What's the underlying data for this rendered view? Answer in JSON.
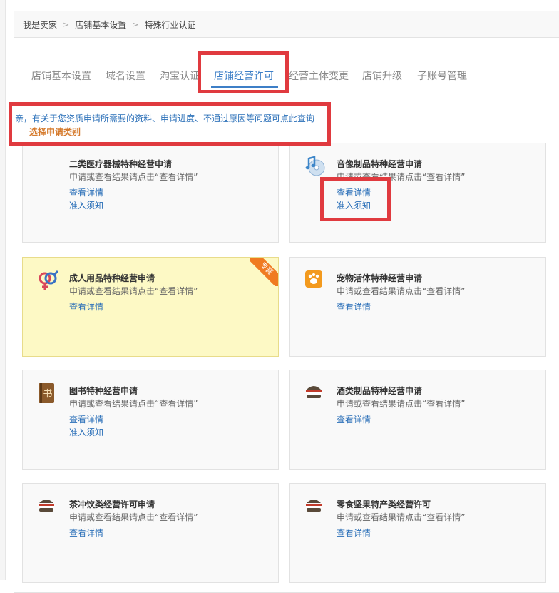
{
  "breadcrumb": [
    "我是卖家",
    "店铺基本设置",
    "特殊行业认证"
  ],
  "breadcrumb_separator": ">",
  "tabs": [
    {
      "label": "店铺基本设置",
      "active": false
    },
    {
      "label": "域名设置",
      "active": false
    },
    {
      "label": "淘宝认证",
      "active": false
    },
    {
      "label": "店铺经营许可",
      "active": true
    },
    {
      "label": "经营主体变更",
      "active": false
    },
    {
      "label": "店铺升级",
      "active": false
    },
    {
      "label": "子账号管理",
      "active": false
    }
  ],
  "notice": "亲，有关于您资质申请所需要的资料、申请进度、不通过原因等问题可点此查询",
  "category_title": "选择申请类别",
  "cards": [
    {
      "title": "二类医疗器械特种经营申请",
      "desc": "申请或查看结果请点击“查看详情”",
      "link1": "查看详情",
      "link2": "准入须知",
      "icon": "none"
    },
    {
      "title": "音像制品特种经营申请",
      "desc": "申请或查看结果请点击“查看详情”",
      "link1": "查看详情",
      "link2": "准入须知",
      "icon": "music-disc-icon"
    },
    {
      "title": "成人用品特种经营申请",
      "desc": "申请或查看结果请点击“查看详情”",
      "link1": "查看详情",
      "icon": "gender-icon",
      "badge": "专营"
    },
    {
      "title": "宠物活体特种经营申请",
      "desc": "申请或查看结果请点击“查看详情”",
      "link1": "查看详情",
      "icon": "paw-icon"
    },
    {
      "title": "图书特种经营申请",
      "desc": "申请或查看结果请点击“查看详情”",
      "link1": "查看详情",
      "link2": "准入须知",
      "icon": "book-icon",
      "icon_text": "书"
    },
    {
      "title": "酒类制品特种经营申请",
      "desc": "申请或查看结果请点击“查看详情”",
      "link1": "查看详情",
      "icon": "burger-icon"
    },
    {
      "title": "茶冲饮类经营许可申请",
      "desc": "申请或查看结果请点击“查看详情”",
      "link1": "查看详情",
      "icon": "burger-icon"
    },
    {
      "title": "零食坚果特产类经营许可",
      "desc": "申请或查看结果请点击“查看详情”",
      "link1": "查看详情",
      "icon": "burger-icon"
    }
  ],
  "colors": {
    "accent": "#3d7fc7",
    "annotation": "#e03a3f",
    "highlight": "#fdf9c5",
    "link": "#2a6fb8"
  }
}
